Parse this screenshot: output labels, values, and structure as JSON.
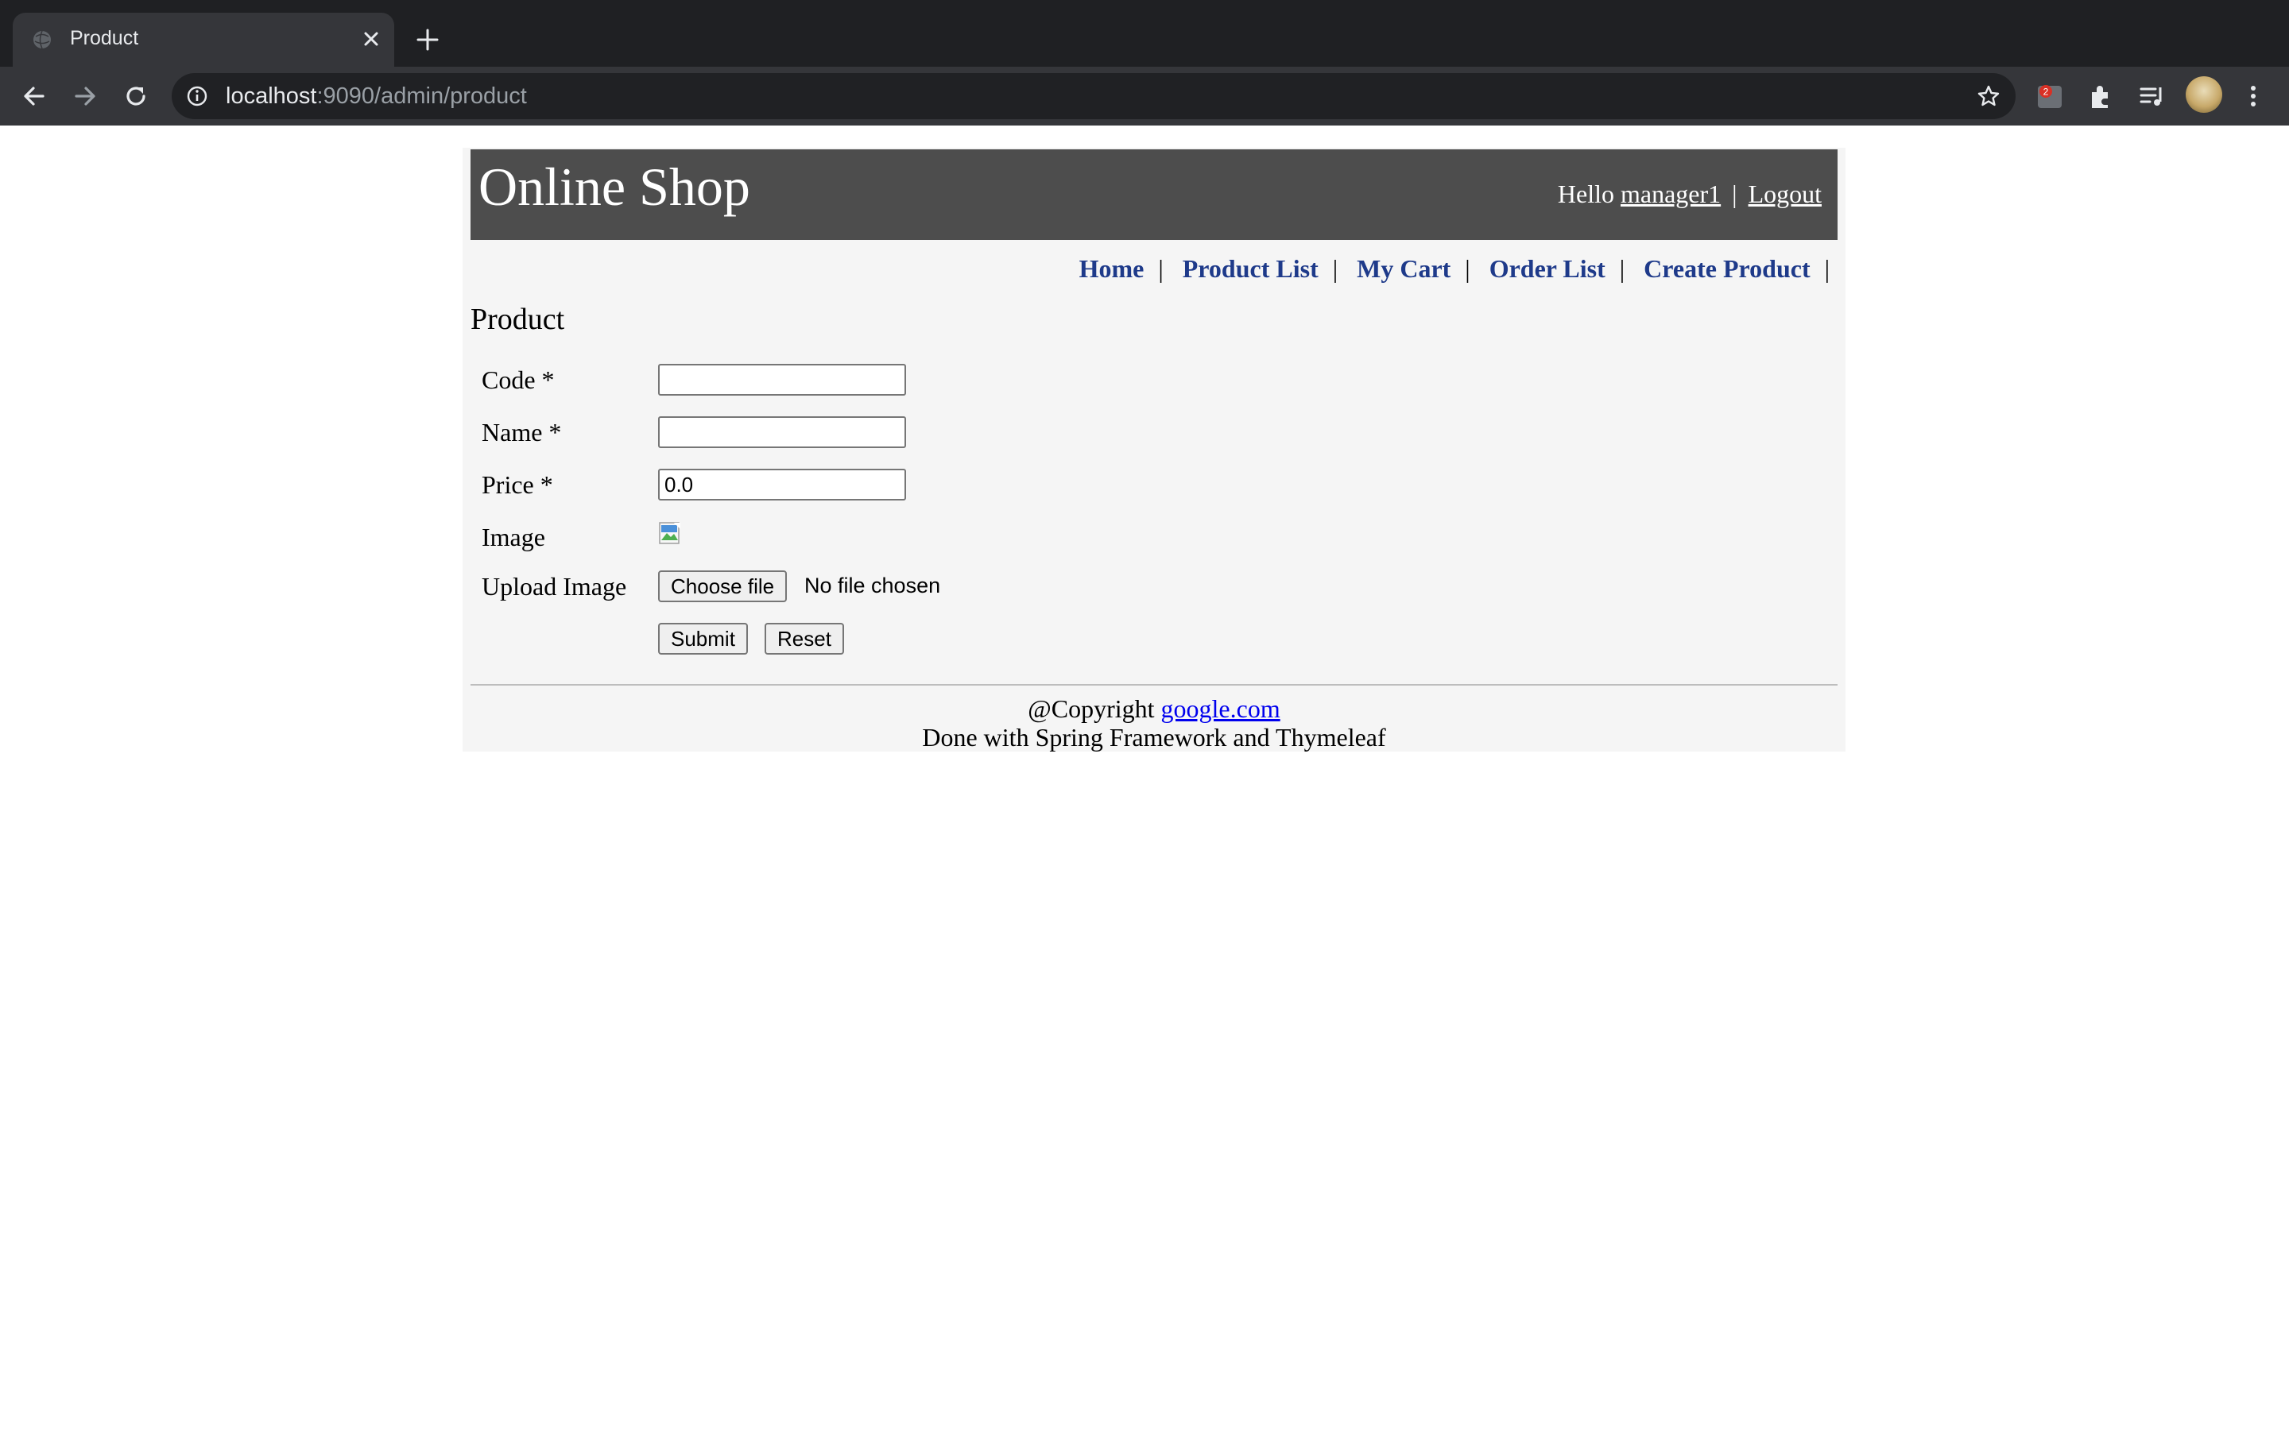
{
  "browser": {
    "tab": {
      "title": "Product"
    },
    "address_bar": {
      "host": "localhost",
      "path": ":9090/admin/product"
    }
  },
  "header": {
    "site_title": "Online Shop",
    "greeting_prefix": "Hello",
    "username": "manager1",
    "separator": "|",
    "logout_label": "Logout"
  },
  "menu": {
    "items": [
      {
        "label": "Home"
      },
      {
        "label": "Product List"
      },
      {
        "label": "My Cart"
      },
      {
        "label": "Order List"
      },
      {
        "label": "Create Product"
      }
    ],
    "separator": "|"
  },
  "form": {
    "title": "Product",
    "code": {
      "label": "Code *",
      "value": ""
    },
    "name": {
      "label": "Name *",
      "value": ""
    },
    "price": {
      "label": "Price *",
      "value": "0.0"
    },
    "image": {
      "label": "Image"
    },
    "upload": {
      "label": "Upload Image",
      "button_label": "Choose file",
      "status": "No file chosen"
    },
    "submit_label": "Submit",
    "reset_label": "Reset"
  },
  "footer": {
    "copyright_prefix": "@Copyright",
    "copyright_link": "google.com",
    "credit": "Done with Spring Framework and Thymeleaf"
  },
  "colors": {
    "header_bg": "#4d4d4d",
    "page_bg": "#f5f5f5",
    "menu_link": "#1e3a8a",
    "chrome_bg": "#35363a"
  }
}
